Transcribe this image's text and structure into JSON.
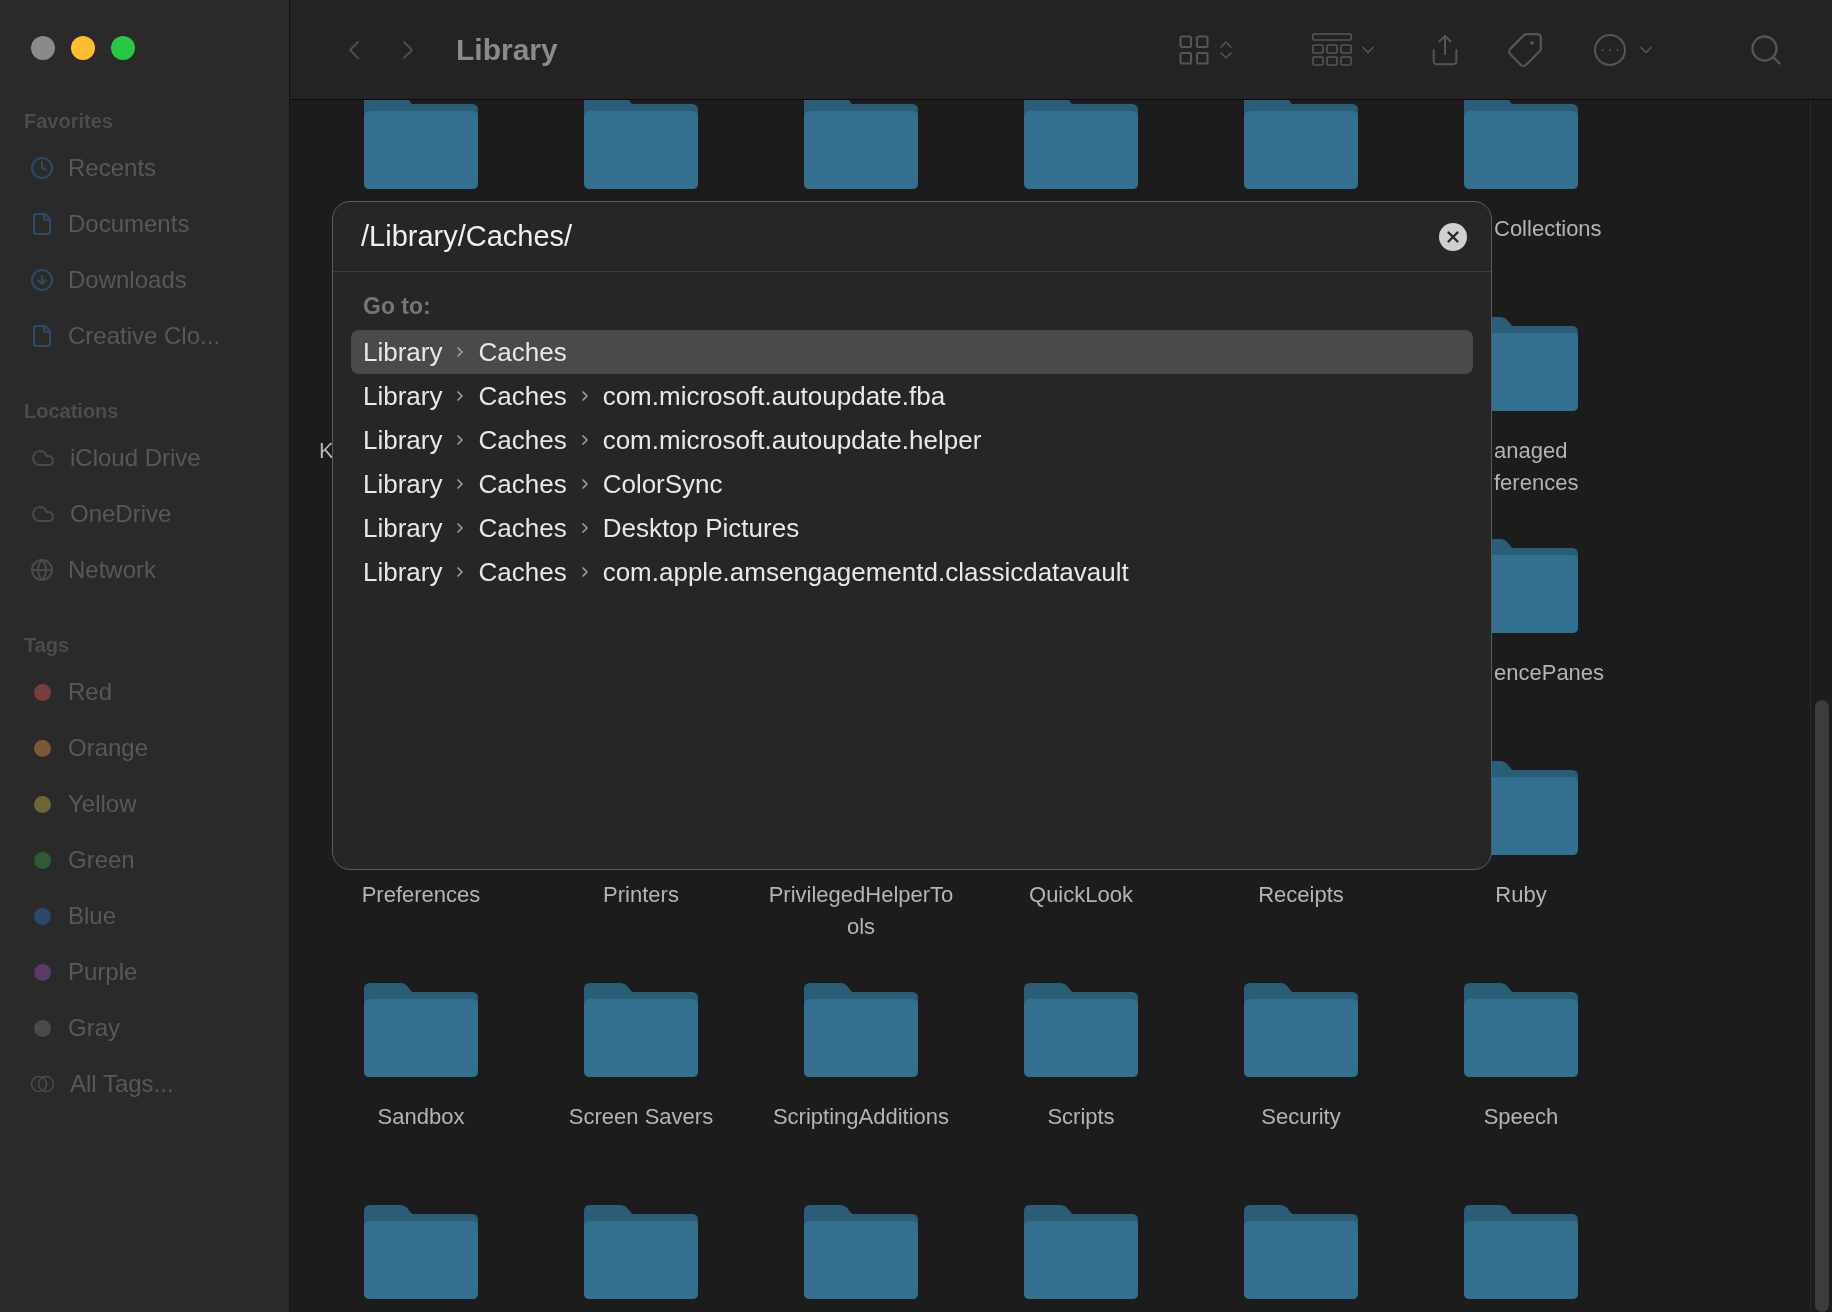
{
  "window": {
    "title": "Library"
  },
  "sidebar": {
    "sections": [
      {
        "title": "Favorites",
        "items": [
          {
            "label": "Recents",
            "kind": "clock"
          },
          {
            "label": "Documents",
            "kind": "document"
          },
          {
            "label": "Downloads",
            "kind": "download"
          },
          {
            "label": "Creative Clo...",
            "kind": "document"
          }
        ]
      },
      {
        "title": "Locations",
        "items": [
          {
            "label": "iCloud Drive",
            "kind": "cloud"
          },
          {
            "label": "OneDrive",
            "kind": "cloud"
          },
          {
            "label": "Network",
            "kind": "globe"
          }
        ]
      },
      {
        "title": "Tags",
        "items": [
          {
            "label": "Red",
            "kind": "tag",
            "color": "#7a3d3b"
          },
          {
            "label": "Orange",
            "kind": "tag",
            "color": "#7a5a34"
          },
          {
            "label": "Yellow",
            "kind": "tag",
            "color": "#6f6532"
          },
          {
            "label": "Green",
            "kind": "tag",
            "color": "#2f5a36"
          },
          {
            "label": "Blue",
            "kind": "tag",
            "color": "#2a4a6a"
          },
          {
            "label": "Purple",
            "kind": "tag",
            "color": "#5a3a66"
          },
          {
            "label": "Gray",
            "kind": "tag",
            "color": "#4a4a4c"
          },
          {
            "label": "All Tags...",
            "kind": "all-tags"
          }
        ]
      }
    ]
  },
  "grid": {
    "rows": [
      {
        "items": [
          {
            "kind": "folder"
          },
          {
            "kind": "folder"
          },
          {
            "kind": "folder"
          },
          {
            "kind": "folder"
          },
          {
            "kind": "folder"
          },
          {
            "kind": "peek",
            "label": "Collections"
          }
        ]
      },
      {
        "items": [
          {
            "kind": "edge",
            "label": "K"
          },
          {
            "kind": "covered"
          },
          {
            "kind": "covered"
          },
          {
            "kind": "covered"
          },
          {
            "kind": "covered"
          },
          {
            "kind": "peek",
            "label": "anaged ferences"
          }
        ]
      },
      {
        "items": [
          {
            "kind": "covered"
          },
          {
            "kind": "covered"
          },
          {
            "kind": "covered"
          },
          {
            "kind": "covered"
          },
          {
            "kind": "covered"
          },
          {
            "kind": "peek",
            "label": "encePanes"
          }
        ]
      },
      {
        "items": [
          {
            "kind": "label",
            "label": "Preferences"
          },
          {
            "kind": "label",
            "label": "Printers"
          },
          {
            "kind": "label",
            "label": "PrivilegedHelperTools"
          },
          {
            "kind": "label",
            "label": "QuickLook"
          },
          {
            "kind": "label",
            "label": "Receipts"
          },
          {
            "kind": "folder",
            "label": "Ruby"
          }
        ]
      },
      {
        "items": [
          {
            "kind": "folder",
            "label": "Sandbox"
          },
          {
            "kind": "folder",
            "label": "Screen Savers"
          },
          {
            "kind": "folder",
            "label": "ScriptingAdditions"
          },
          {
            "kind": "folder",
            "label": "Scripts"
          },
          {
            "kind": "folder",
            "label": "Security"
          },
          {
            "kind": "folder",
            "label": "Speech"
          }
        ]
      },
      {
        "items": [
          {
            "kind": "folder"
          },
          {
            "kind": "folder"
          },
          {
            "kind": "folder"
          },
          {
            "kind": "folder"
          },
          {
            "kind": "folder"
          },
          {
            "kind": "folder"
          }
        ]
      }
    ]
  },
  "go_to_dialog": {
    "path": "/Library/Caches/",
    "heading": "Go to:",
    "suggestions": [
      {
        "segments": [
          "Library",
          "Caches"
        ],
        "selected": true
      },
      {
        "segments": [
          "Library",
          "Caches",
          "com.microsoft.autoupdate.fba"
        ],
        "selected": false
      },
      {
        "segments": [
          "Library",
          "Caches",
          "com.microsoft.autoupdate.helper"
        ],
        "selected": false
      },
      {
        "segments": [
          "Library",
          "Caches",
          "ColorSync"
        ],
        "selected": false
      },
      {
        "segments": [
          "Library",
          "Caches",
          "Desktop Pictures"
        ],
        "selected": false
      },
      {
        "segments": [
          "Library",
          "Caches",
          "com.apple.amsengagementd.classicdatavault"
        ],
        "selected": false
      }
    ]
  }
}
